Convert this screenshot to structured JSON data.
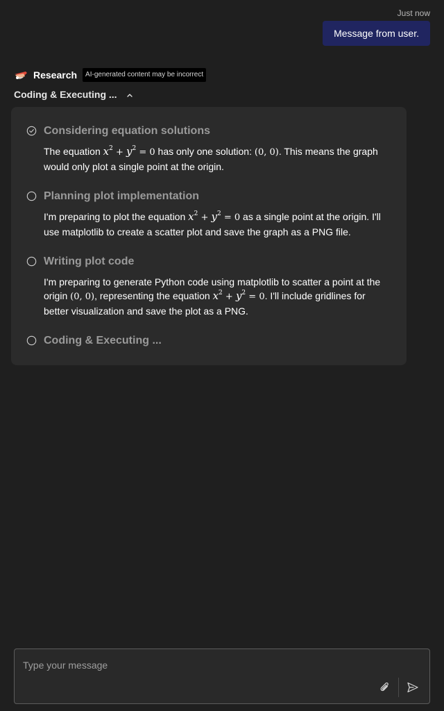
{
  "header": {
    "timestamp": "Just now",
    "user_message": "Message from user."
  },
  "agent": {
    "icon": "research-boat-icon",
    "name": "Research",
    "badge": "AI-generated content may be incorrect"
  },
  "status": {
    "title": "Coding & Executing ...",
    "chevron_icon": "chevron-up-icon"
  },
  "steps": [
    {
      "icon": "check-circle-icon",
      "title": "Considering equation solutions",
      "body_before": "The equation ",
      "body_mid": " has only one solution: ",
      "body_after": ". This means the graph would only plot a single point at the origin."
    },
    {
      "icon": "empty-circle-icon",
      "title": "Planning plot implementation",
      "body_before": "I'm preparing to plot the equation ",
      "body_after": " as a single point at the origin. I'll use matplotlib to create a scatter plot and save the graph as a PNG file."
    },
    {
      "icon": "empty-circle-icon",
      "title": "Writing plot code",
      "body_before": "I'm preparing to generate Python code using matplotlib to scatter a point at the origin ",
      "body_mid": ", representing the equation ",
      "body_after": ". I'll include gridlines for better visualization and save the plot as a PNG."
    },
    {
      "icon": "empty-circle-icon",
      "title": "Coding & Executing ..."
    }
  ],
  "math": {
    "equation_x": "x",
    "equation_y": "y",
    "exponent": "2",
    "plus": " + ",
    "equals_zero": " = 0",
    "origin": "(0, 0)"
  },
  "composer": {
    "placeholder": "Type your message",
    "value": "",
    "attach_icon": "paperclip-icon",
    "send_icon": "send-icon"
  },
  "colors": {
    "background": "#1f1f1f",
    "user_bubble": "#202560",
    "card": "#2b2b2b",
    "step_title": "#9a9a9a"
  }
}
